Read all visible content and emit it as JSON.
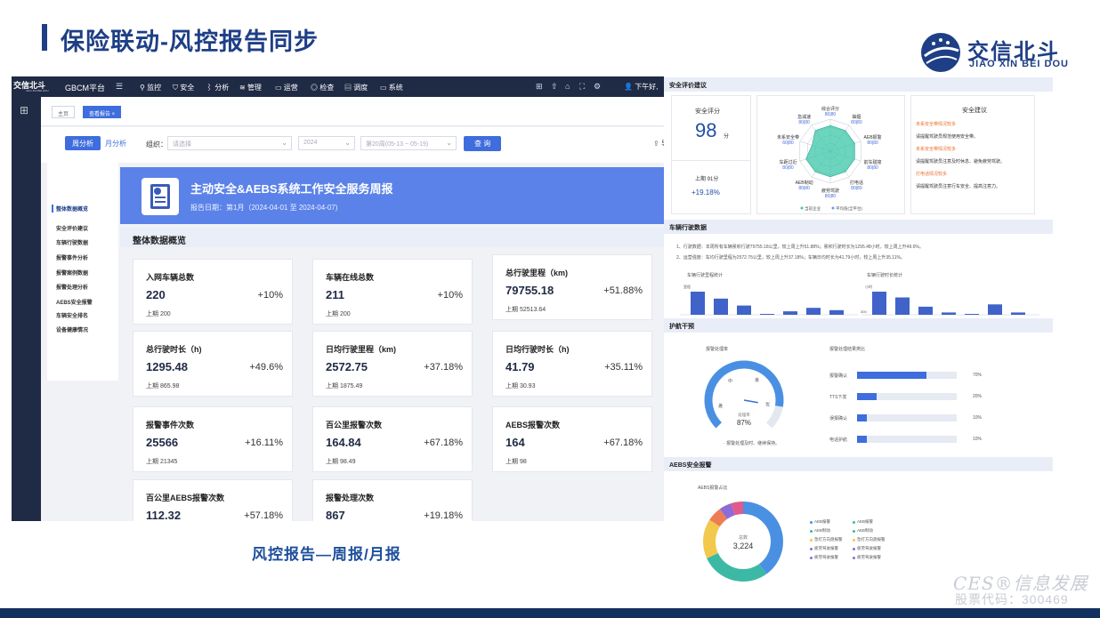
{
  "slide": {
    "title": "保险联动-风控报告同步",
    "caption": "风控报告—周报/月报",
    "brand_cn": "交信北斗",
    "brand_en": "JIAO XIN BEI DOU",
    "watermark": "CES®信息发展",
    "watermark_code": "股票代码：300469"
  },
  "app": {
    "logo": "交信北斗",
    "logo_sub": "JIAO XIN BEI DOU",
    "platform": "GBCM平台",
    "nav": [
      "监控",
      "安全",
      "分析",
      "管理",
      "运营",
      "检查",
      "调度",
      "系统"
    ],
    "user": "下午好,",
    "breadcrumbs": [
      "主页",
      "查看报告 ×"
    ],
    "tabs": [
      "周分析",
      "月分析"
    ],
    "org_label": "组织：",
    "org_placeholder": "请选择",
    "year": "2024",
    "week": "第20周(05-13 ~ 05-19)",
    "query": "查 询",
    "export": "导出",
    "menu": [
      "整体数据概览",
      "安全评价建议",
      "车辆行驶数据",
      "报警事件分析",
      "报警案例数据",
      "报警处理分析",
      "AEBS安全报警",
      "车辆安全排名",
      "设备健康情况"
    ],
    "banner_title": "主动安全&AEBS系统工作安全服务周报",
    "banner_date": "报告日期：第1月（2024-04-01 至 2024-04-07)",
    "section": "整体数据概览",
    "cards": [
      {
        "label": "入网车辆总数",
        "value": "220",
        "pct": "+10%",
        "prev": "上期 200"
      },
      {
        "label": "车辆在线总数",
        "value": "211",
        "pct": "+10%",
        "prev": "上期 200"
      },
      {
        "label": "总行驶里程（km)",
        "value": "79755.18",
        "pct": "+51.88%",
        "prev": "上期 52513.64"
      },
      {
        "label": "总行驶时长（h)",
        "value": "1295.48",
        "pct": "+49.6%",
        "prev": "上期 865.98"
      },
      {
        "label": "日均行驶里程（km)",
        "value": "2572.75",
        "pct": "+37.18%",
        "prev": "上期 1875.49"
      },
      {
        "label": "日均行驶时长（h)",
        "value": "41.79",
        "pct": "+35.11%",
        "prev": "上期 30.93"
      },
      {
        "label": "报警事件次数",
        "value": "25566",
        "pct": "+16.11%",
        "prev": "上期 21345"
      },
      {
        "label": "百公里报警次数",
        "value": "164.84",
        "pct": "+67.18%",
        "prev": "上期 98.49"
      },
      {
        "label": "AEBS报警次数",
        "value": "164",
        "pct": "+67.18%",
        "prev": "上期 98"
      },
      {
        "label": "百公里AEBS报警次数",
        "value": "112.32",
        "pct": "+57.18%",
        "prev": ""
      },
      {
        "label": "报警处理次数",
        "value": "867",
        "pct": "+19.18%",
        "prev": ""
      }
    ]
  },
  "right": {
    "safety_head": "安全评价建议",
    "score_label": "安全评分",
    "score": "98",
    "score_unit": "分",
    "last_label": "上期 91分",
    "last_pct": "+19.18%",
    "radar_labels": [
      "综合评分",
      "急减速",
      "未系安全带",
      "车距过近",
      "AEB制动",
      "疲劳驾驶",
      "打电话",
      "前车碰撞",
      "AEB报警",
      "抽烟"
    ],
    "radar_values": [
      "80|80",
      "80|80",
      "60|80",
      "80|80",
      "80|80",
      "80|80",
      "80|80",
      "80|80",
      "80|80",
      "80|80"
    ],
    "radar_legend": [
      "当前企业",
      "平均值(全平台)"
    ],
    "advice_title": "安全建议",
    "advice": [
      {
        "t": "未系安全带情况较多",
        "c": "#e8722c"
      },
      {
        "t": "请提醒驾驶员规范使用安全带。",
        "c": "#333333"
      },
      {
        "t": "未系安全带情况较多",
        "c": "#e8722c"
      },
      {
        "t": "请提醒驾驶员注意及时休息、避免疲劳驾驶。",
        "c": "#333333"
      },
      {
        "t": "打电话情况较多",
        "c": "#e8722c"
      },
      {
        "t": "请提醒驾驶员注意行车安全、提高注意力。",
        "c": "#333333"
      }
    ],
    "drive_head": "车辆行驶数据",
    "drive_line1": "1、行驶数据：本周所有车辆累积行驶79755.18公里，较上周上升51.88%；累积行驶时长为1295.48小时，较上周上升49.6%。",
    "drive_line2": "2、运营强度：车均行驶里程为2572.75公里，较上周上升37.18%；车辆日均时长为41.79小时，较上周上升35.11%。",
    "mile_title": "车辆行驶里程统计",
    "mile_unit": "里程",
    "dur_title": "车辆行驶时长统计",
    "dur_unit": "小时",
    "dur_tick": "300",
    "nav_head": "护航干预",
    "rate_title": "报警处理率",
    "rate_value": "87%",
    "rate_note": "报警处理及时、继续保持。",
    "gauge_labels": [
      "差",
      "中",
      "良",
      "优"
    ],
    "gauge_inner": "处理率",
    "result_title": "报警处理结果类比",
    "results": [
      {
        "label": "报警确认",
        "pct": "70%",
        "v": 70
      },
      {
        "label": "TTS下发",
        "pct": "20%",
        "v": 20
      },
      {
        "label": "误报确认",
        "pct": "10%",
        "v": 10
      },
      {
        "label": "电话护航",
        "pct": "10%",
        "v": 10
      }
    ],
    "aebs_head": "AEBS安全报警",
    "donut_title": "AEBS报警占比",
    "donut_label": "总数",
    "donut_total": "3,224",
    "legend": [
      "AEB报警",
      "AEB报警",
      "AEB制动",
      "AEB制动",
      "急打方向盘报警",
      "急打方向盘报警",
      "疲劳驾驶报警",
      "疲劳驾驶报警",
      "疲劳驾驶报警",
      "疲劳驾驶报警"
    ]
  },
  "chart_data": [
    {
      "type": "bar",
      "title": "车辆行驶里程统计",
      "ylabel": "里程",
      "categories": [
        "1",
        "2",
        "3",
        "4",
        "5",
        "6",
        "7"
      ],
      "values": [
        100,
        70,
        40,
        0,
        15,
        30,
        20
      ]
    },
    {
      "type": "bar",
      "title": "车辆行驶时长统计",
      "ylabel": "小时",
      "categories": [
        "1",
        "2",
        "3",
        "4",
        "5",
        "6",
        "7"
      ],
      "values": [
        100,
        75,
        35,
        10,
        0,
        45,
        10
      ]
    },
    {
      "type": "pie",
      "title": "AEBS报警占比",
      "center_label": "总数",
      "total": "3,224",
      "series": [
        {
          "values": [
            40,
            28,
            16,
            6,
            5,
            5
          ]
        }
      ],
      "colors": [
        "#4a90e2",
        "#3cb9a4",
        "#f2c94c",
        "#ef7d54",
        "#8e6bd6",
        "#e05a8a"
      ]
    },
    {
      "type": "bar",
      "title": "报警处理结果类比",
      "categories": [
        "报警确认",
        "TTS下发",
        "误报确认",
        "电话护航"
      ],
      "values": [
        70,
        20,
        10,
        10
      ]
    }
  ],
  "colors": {
    "nav": "#1f2a44",
    "accent": "#3f6ddd",
    "banner": "#5b82e8",
    "brand": "#1e3f86",
    "gauge": "#4a90e2"
  }
}
